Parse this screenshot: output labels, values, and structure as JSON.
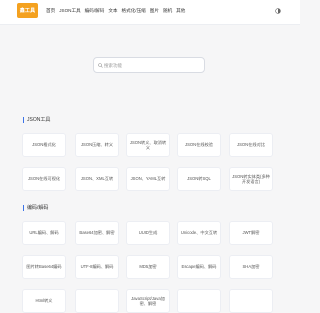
{
  "logo": {
    "text": "鑫工具"
  },
  "nav": [
    "首页",
    "JSON工具",
    "编码/解码",
    "文本",
    "格式化/压缩",
    "图片",
    "随机",
    "其他"
  ],
  "search": {
    "placeholder": "搜索功能"
  },
  "sections": [
    {
      "title": "JSON工具",
      "items": [
        "JSON格式化",
        "JSON压缩、转义",
        "JSON转义、取消转义",
        "JSON在线校验",
        "JSON在线对比",
        "JSON在线可视化",
        "JSON、XML互转",
        "JSON、YAML互转",
        "JSON转SQL",
        "JSON转实体类(多种开发语言)"
      ]
    },
    {
      "title": "编码/解码",
      "items": [
        "URL编码、解码",
        "Base64加密、解密",
        "UUID生成",
        "Unicode、中文互转",
        "JWT解密",
        "图片转Base64编码",
        "UTF-8编码、解码",
        "MD5加密",
        "Escape编码、解码",
        "SHA加密",
        "Html转义",
        "",
        "JavaScript/Java加密、解密",
        "",
        ""
      ]
    }
  ]
}
